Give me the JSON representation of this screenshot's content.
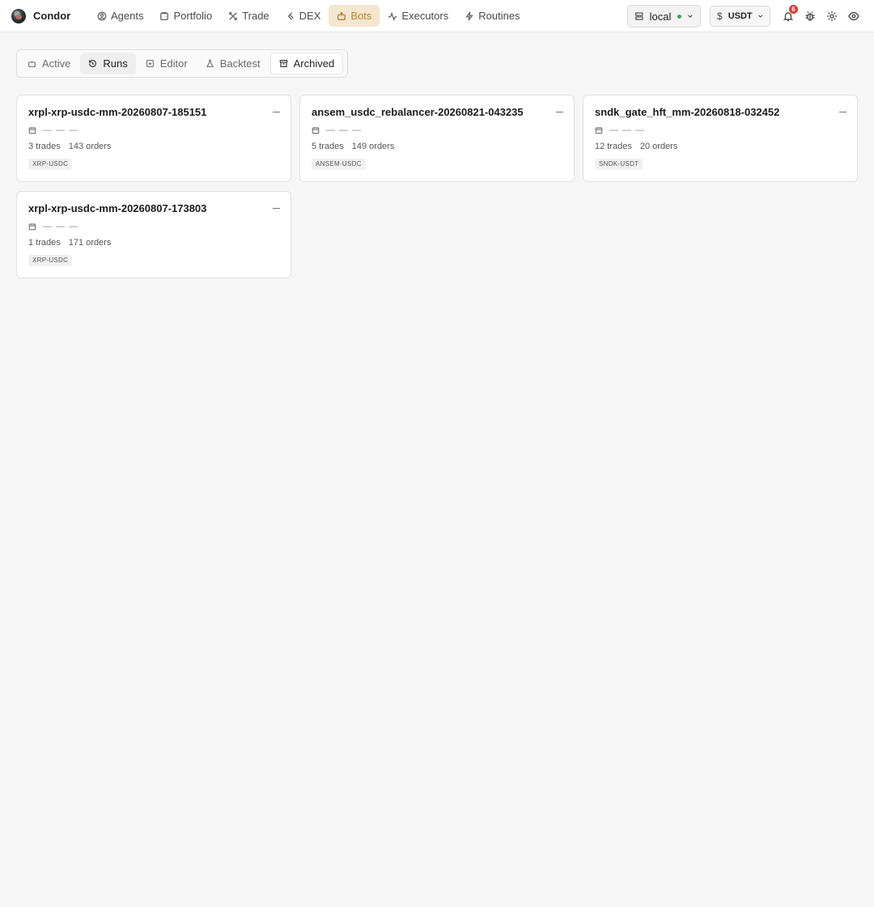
{
  "app": {
    "name": "Condor"
  },
  "nav": {
    "items": [
      {
        "label": "Agents",
        "icon": "agents-icon"
      },
      {
        "label": "Portfolio",
        "icon": "portfolio-icon"
      },
      {
        "label": "Trade",
        "icon": "trade-icon"
      },
      {
        "label": "DEX",
        "icon": "dex-icon"
      },
      {
        "label": "Bots",
        "icon": "bot-icon",
        "active": true
      },
      {
        "label": "Executors",
        "icon": "executors-icon"
      },
      {
        "label": "Routines",
        "icon": "routines-icon"
      }
    ]
  },
  "header": {
    "environment": {
      "value": "local",
      "status_color": "#3fa34d"
    },
    "currency": {
      "symbol": "$",
      "value": "USDT"
    },
    "notifications": {
      "count": "6"
    }
  },
  "tabs": [
    {
      "label": "Active",
      "icon": "bot-icon"
    },
    {
      "label": "Runs",
      "icon": "history-icon",
      "selected": true
    },
    {
      "label": "Editor",
      "icon": "editor-icon"
    },
    {
      "label": "Backtest",
      "icon": "flask-icon"
    },
    {
      "label": "Archived",
      "icon": "archive-icon",
      "current": true
    }
  ],
  "runs": [
    {
      "name": "xrpl-xrp-usdc-mm-20260807-185151",
      "date": "— — —",
      "trades": "3 trades",
      "orders": "143 orders",
      "pair": "XRP-USDC"
    },
    {
      "name": "ansem_usdc_rebalancer-20260821-043235",
      "date": "— — —",
      "trades": "5 trades",
      "orders": "149 orders",
      "pair": "ANSEM-USDC"
    },
    {
      "name": "sndk_gate_hft_mm-20260818-032452",
      "date": "— — —",
      "trades": "12 trades",
      "orders": "20 orders",
      "pair": "SNDK-USDT"
    },
    {
      "name": "xrpl-xrp-usdc-mm-20260807-173803",
      "date": "— — —",
      "trades": "1 trades",
      "orders": "171 orders",
      "pair": "XRP-USDC"
    }
  ],
  "colors": {
    "accent": "#b98233",
    "accent_bg": "#f3e7d0",
    "badge": "#e03b2f"
  }
}
